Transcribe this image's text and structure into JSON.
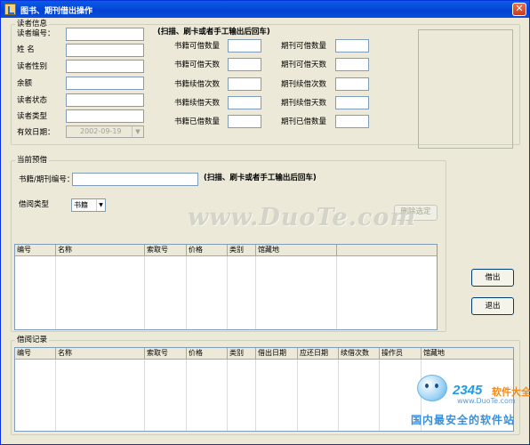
{
  "window": {
    "title": "图书、期刊借出操作",
    "close_glyph": "✕"
  },
  "reader": {
    "group_label": "读者信息",
    "reader_id_label": "读者编号：",
    "name_label": "姓  名",
    "gender_label": "读者性别",
    "balance_label": "余额",
    "status_label": "读者状态",
    "type_label": "读者类型",
    "expiry_label": "有效日期：",
    "expiry_value": "2002-09-19",
    "scan_hint": "(扫描、刷卡或者手工输出后回车)"
  },
  "quota": {
    "book_borrowable_count": "书籍可借数量",
    "book_borrowable_days": "书籍可借天数",
    "book_renew_times": "书籍续借次数",
    "book_renew_days": "书籍续借天数",
    "book_borrowed_count": "书籍已借数量",
    "journal_borrowable_count": "期刊可借数量",
    "journal_borrowable_days": "期刊可借天数",
    "journal_renew_times": "期刊续借次数",
    "journal_renew_days": "期刊续借天数",
    "journal_borrowed_count": "期刊已借数量"
  },
  "current": {
    "group_label": "当前预借",
    "item_id_label": "书籍/期刊编号：",
    "scan_hint": "(扫描、刷卡或者手工输出后回车)",
    "borrow_type_label": "借阅类型",
    "borrow_type_value": "书籍",
    "delete_selected_button": "删除选定",
    "columns": [
      "编号",
      "名称",
      "索取号",
      "价格",
      "类别",
      "馆藏地"
    ]
  },
  "actions": {
    "lend_button": "借出",
    "exit_button": "退出"
  },
  "history": {
    "group_label": "借阅记录",
    "columns": [
      "编号",
      "名称",
      "索取号",
      "价格",
      "类别",
      "借出日期",
      "应还日期",
      "续借次数",
      "操作员",
      "馆藏地"
    ]
  },
  "watermark": {
    "text": "www.DuoTe.com"
  },
  "site_logo": {
    "brand_number": "2345",
    "brand_text": "软件大全",
    "url": "www.DuoTe.com",
    "slogan": "国内最安全的软件站"
  },
  "colors": {
    "titlebar": "#0a5ce8",
    "window_bg": "#ece9d8",
    "field_border": "#7f9db9"
  }
}
